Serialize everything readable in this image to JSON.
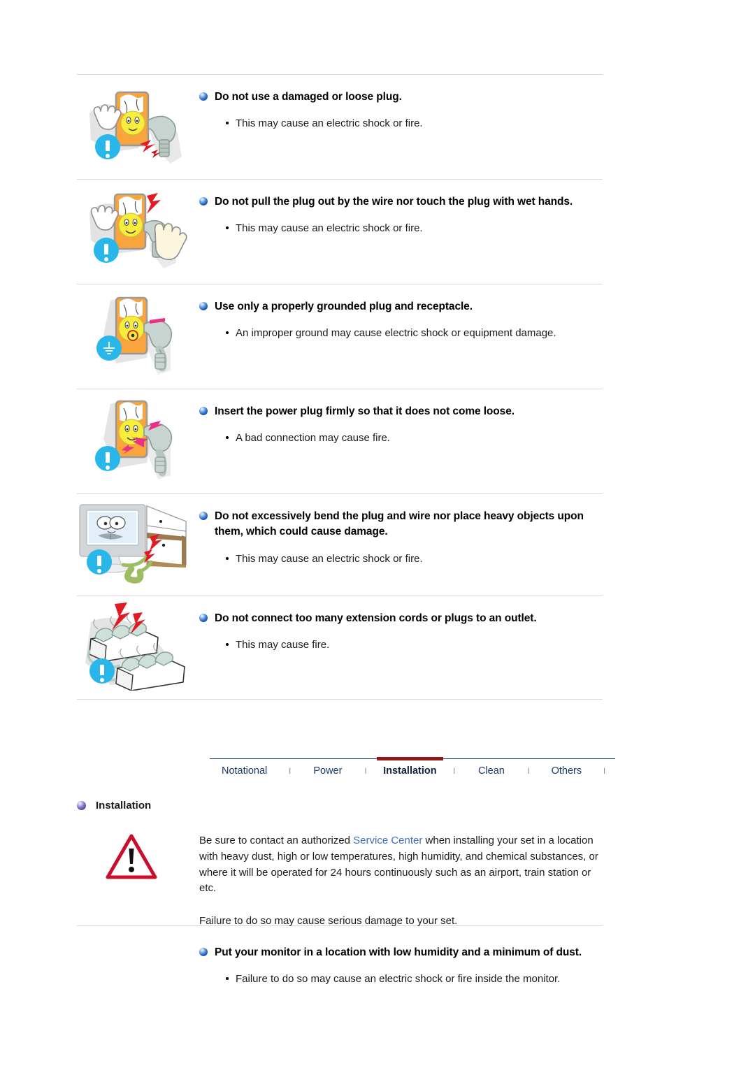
{
  "document": {
    "title": "Safety Instructions - Power / Installation"
  },
  "safety_items": [
    {
      "id": "damaged-plug",
      "heading": "Do not use a damaged or loose plug.",
      "note": "This may cause an electric shock or fire.",
      "badge_icon": "exclamation-badge-icon",
      "illustration": "outlet-hand-damaged-plug-illustration"
    },
    {
      "id": "wet-hands",
      "heading": "Do not pull the plug out by the wire nor touch the plug with wet hands.",
      "note": "This may cause an electric shock or fire.",
      "badge_icon": "exclamation-badge-icon",
      "illustration": "outlet-wet-hands-illustration"
    },
    {
      "id": "grounded-plug",
      "heading": "Use only a properly grounded plug and receptacle.",
      "note": "An improper ground may cause electric shock or equipment damage.",
      "badge_icon": "earth-ground-badge-icon",
      "illustration": "grounded-plug-outlet-illustration"
    },
    {
      "id": "insert-firmly",
      "heading": "Insert the power plug firmly so that it does not come loose.",
      "note": "A bad connection may cause fire.",
      "badge_icon": "exclamation-badge-icon",
      "illustration": "plug-insert-firmly-illustration"
    },
    {
      "id": "bend-plug",
      "heading": "Do not excessively bend the plug and wire nor place heavy objects upon them, which could cause damage.",
      "note": "This may cause an electric shock or fire.",
      "badge_icon": "exclamation-badge-icon",
      "illustration": "monitor-bent-cable-illustration"
    },
    {
      "id": "extension-cords",
      "heading": "Do not connect too many extension cords or plugs to an outlet.",
      "note": "This may cause fire.",
      "badge_icon": "exclamation-badge-icon",
      "illustration": "overloaded-power-strips-illustration"
    }
  ],
  "tabnav": {
    "tabs": [
      {
        "label": "Notational",
        "active": false
      },
      {
        "label": "Power",
        "active": false
      },
      {
        "label": "Installation",
        "active": true
      },
      {
        "label": "Clean",
        "active": false
      },
      {
        "label": "Others",
        "active": false
      }
    ],
    "separator": "I",
    "active_accent_color": "#8c1818",
    "line_color": "#25476f"
  },
  "installation": {
    "section_title": "Installation",
    "warning_icon": "warning-triangle-icon",
    "paragraph_lead": "Be sure to contact an authorized ",
    "paragraph_link": "Service Center",
    "paragraph_rest": " when installing your set in a location with heavy dust, high or low temperatures, high humidity, and chemical substances, or where it will be operated for 24 hours continuously such as an airport, train station or etc.",
    "paragraph_failure": "Failure to do so may cause serious damage to your set.",
    "final_heading": "Put your monitor in a location with low humidity and a minimum of dust.",
    "final_note": "Failure to do so may cause an electric shock or fire inside the monitor."
  },
  "colors": {
    "badge_blue": "#29b6e8",
    "bullet_blue": "#2f6fd0",
    "bullet_purple": "#7a6cc4",
    "link_blue": "#3f6fbf",
    "rule_gray": "#d8d8d8",
    "warning_red": "#c8102e"
  }
}
